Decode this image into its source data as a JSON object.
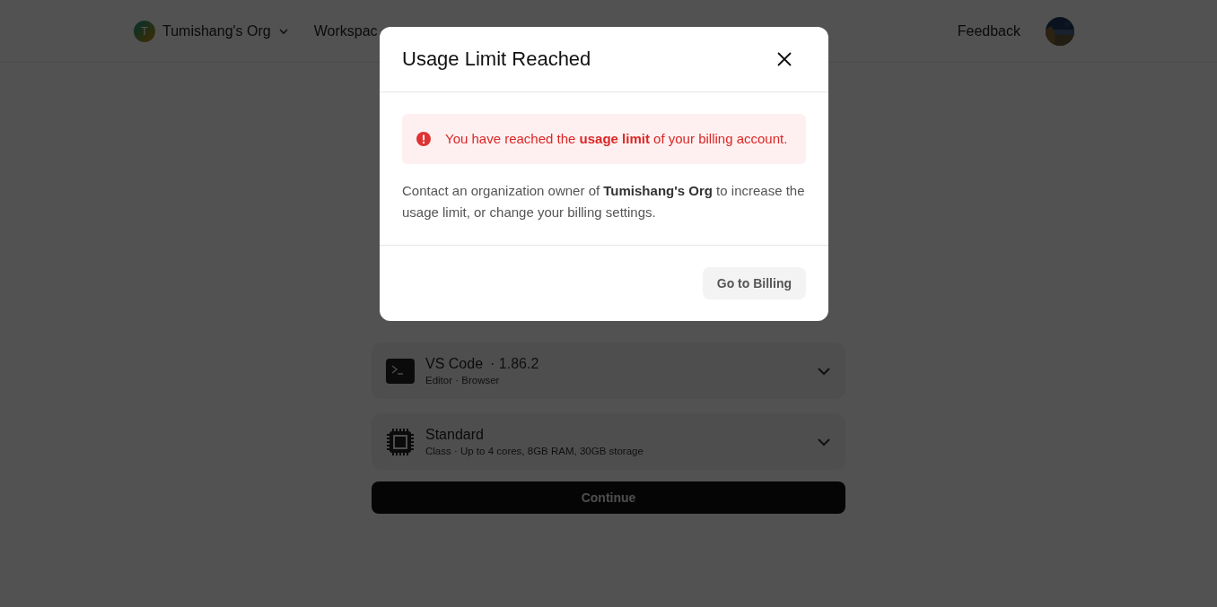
{
  "header": {
    "org": {
      "initial": "T",
      "name": "Tumishang's Org"
    },
    "nav": [
      "Workspac"
    ],
    "feedback": "Feedback"
  },
  "options": [
    {
      "kind": "editor",
      "title": "VS Code",
      "version": "· 1.86.2",
      "subtitle": "Editor · Browser"
    },
    {
      "kind": "class",
      "title": "Standard",
      "subtitle": "Class · Up to 4 cores, 8GB RAM, 30GB storage"
    }
  ],
  "continue_button": "Continue",
  "dialog": {
    "title": "Usage Limit Reached",
    "alert": "You have reached the **usage limit** of your billing account.",
    "message": "Contact an organization owner of **Tumishang's Org** to increase the usage limit, or change your billing settings.",
    "button": "Go to Billing"
  }
}
